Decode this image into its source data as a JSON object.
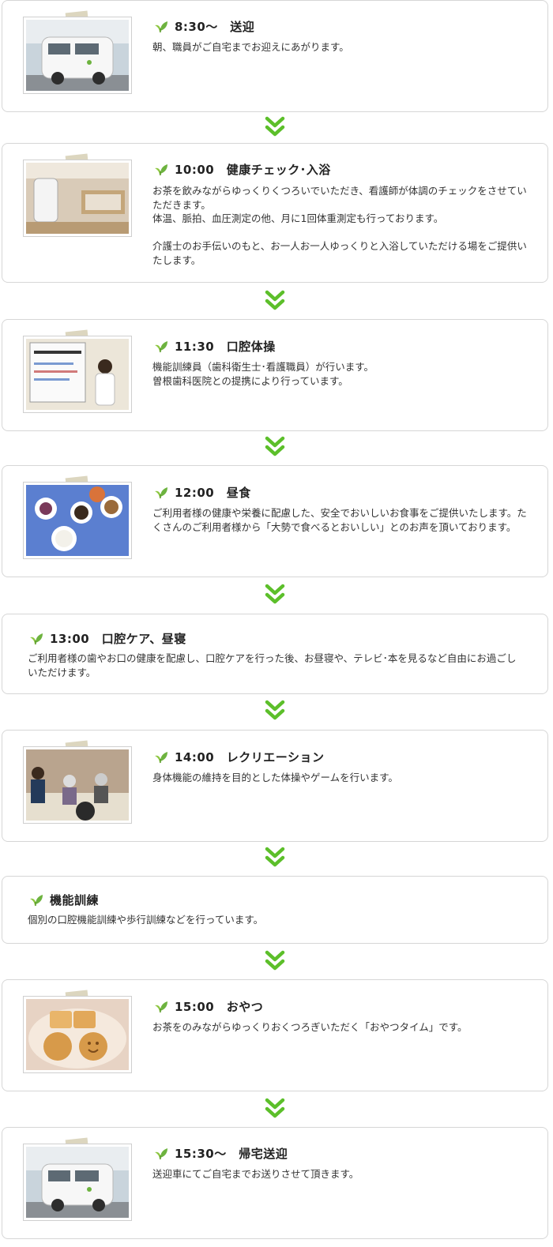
{
  "items": [
    {
      "title": "8:30～　送迎",
      "desc": "朝、職員がご自宅までお迎えにあがります。"
    },
    {
      "title": "10:00　健康チェック･入浴",
      "desc": "お茶を飲みながらゆっくりくつろいでいただき、看護師が体調のチェックをさせていただきます。\n体温、脈拍、血圧測定の他、月に1回体重測定も行っております。\n\n介護士のお手伝いのもと、お一人お一人ゆっくりと入浴していただける場をご提供いたします。"
    },
    {
      "title": "11:30　口腔体操",
      "desc": "機能訓練員（歯科衛生士･看護職員）が行います。\n曽根歯科医院との提携により行っています。"
    },
    {
      "title": "12:00　昼食",
      "desc": "ご利用者様の健康や栄養に配慮した、安全でおいしいお食事をご提供いたします。たくさんのご利用者様から「大勢で食べるとおいしい」とのお声を頂いております。"
    },
    {
      "title": "13:00　口腔ケア、昼寝",
      "desc": "ご利用者様の歯やお口の健康を配慮し、口腔ケアを行った後、お昼寝や、テレビ･本を見るなど自由にお過ごしいただけます。"
    },
    {
      "title": "14:00　レクリエーション",
      "desc": "身体機能の維持を目的とした体操やゲームを行います。"
    },
    {
      "title": "機能訓練",
      "desc": "個別の口腔機能訓練や歩行訓練などを行っています。"
    },
    {
      "title": "15:00　おやつ",
      "desc": "お茶をのみながらゆっくりおくつろぎいただく「おやつタイム」です。"
    },
    {
      "title": "15:30～　帰宅送迎",
      "desc": "送迎車にてご自宅までお送りさせて頂きます。"
    }
  ],
  "colors": {
    "accent": "#5cbf2a",
    "leaf": "#7cc242",
    "border": "#d6d6d6"
  },
  "icons": {
    "leaf": "sprout-icon",
    "arrow": "double-chevron-down-icon"
  }
}
